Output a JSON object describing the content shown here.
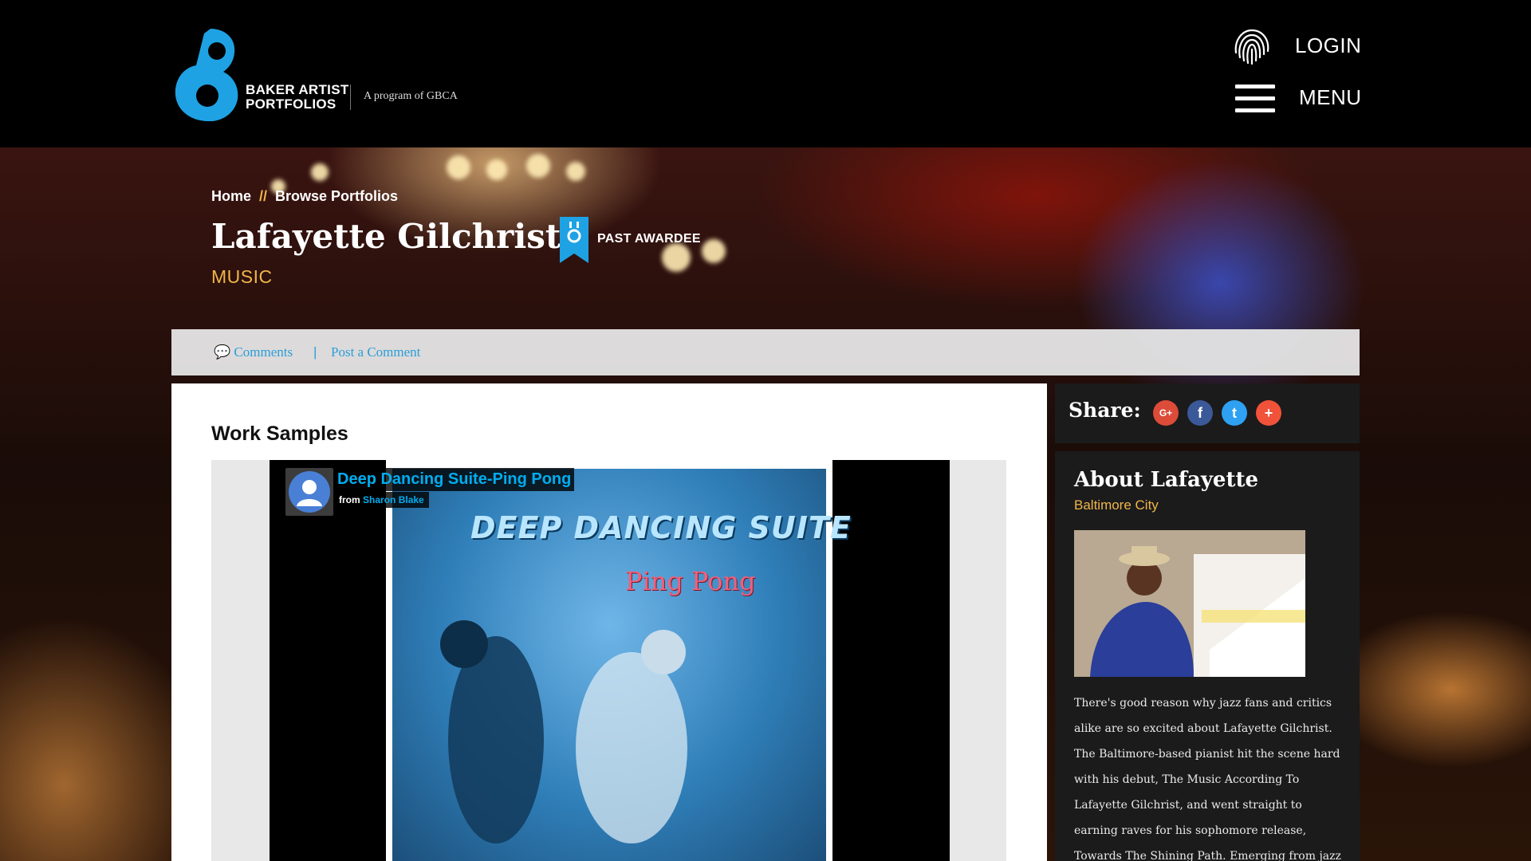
{
  "header": {
    "brand_line1": "BAKER ARTIST",
    "brand_line2": "PORTFOLIOS",
    "tagline": "A program of GBCA",
    "login_label": "LOGIN",
    "menu_label": "MENU",
    "icons": {
      "login": "fingerprint-icon",
      "menu": "hamburger-icon"
    }
  },
  "breadcrumb": {
    "home": "Home",
    "separator": "//",
    "browse": "Browse Portfolios"
  },
  "artist": {
    "name": "Lafayette Gilchrist",
    "award": "PAST AWARDEE",
    "discipline": "MUSIC"
  },
  "comments": {
    "comments_label": "Comments",
    "separator": "|",
    "post_label": "Post a Comment"
  },
  "work_samples": {
    "heading": "Work Samples",
    "video": {
      "title": "Deep Dancing Suite-Ping Pong",
      "from": "from",
      "author": "Sharon Blake",
      "cover_title": "DEEP DANCING SUITE",
      "cover_subtitle": "Ping Pong"
    }
  },
  "share": {
    "label": "Share:",
    "buttons": [
      {
        "name": "google-plus-icon",
        "glyph": "G+",
        "color": "#dd4b39"
      },
      {
        "name": "facebook-icon",
        "glyph": "f",
        "color": "#3b5998"
      },
      {
        "name": "twitter-icon",
        "glyph": "t",
        "color": "#2ea1f2"
      },
      {
        "name": "plus-icon",
        "glyph": "+",
        "color": "#f0523a"
      }
    ]
  },
  "about": {
    "title": "About Lafayette",
    "location": "Baltimore City",
    "bio": "There's good reason why jazz fans and critics alike are so excited about Lafayette Gilchrist. The Baltimore-based pianist hit the scene hard with his debut, The Music According To Lafayette Gilchrist, and went straight to earning raves for his sophomore release, Towards The Shining Path. Emerging from jazz"
  },
  "colors": {
    "accent": "#2b9ed8",
    "gold": "#f0b54a",
    "dark": "#1b1b1b"
  }
}
